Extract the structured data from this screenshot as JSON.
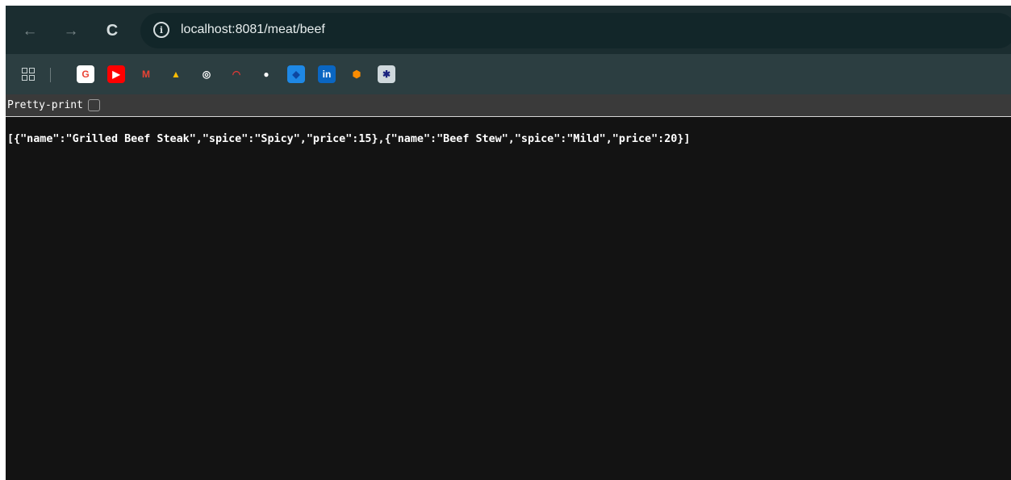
{
  "browser": {
    "url": "localhost:8081/meat/beef",
    "icons": {
      "back": "back-arrow-icon",
      "forward": "forward-arrow-icon",
      "reload": "reload-icon",
      "info": "info-icon"
    }
  },
  "bookmarks": [
    {
      "name": "apps-grid-icon"
    },
    {
      "name": "google-icon",
      "glyph": "G",
      "bg": "#ffffff",
      "fg": "#ea4335"
    },
    {
      "name": "youtube-icon",
      "glyph": "▶",
      "bg": "#ff0000",
      "fg": "#ffffff"
    },
    {
      "name": "gmail-icon",
      "glyph": "M",
      "bg": "transparent",
      "fg": "#ea4335"
    },
    {
      "name": "google-drive-icon",
      "glyph": "▲",
      "bg": "transparent",
      "fg": "#fbbc04"
    },
    {
      "name": "openai-icon",
      "glyph": "◎",
      "bg": "transparent",
      "fg": "#ffffff"
    },
    {
      "name": "speedometer-icon",
      "glyph": "◠",
      "bg": "transparent",
      "fg": "#e53935"
    },
    {
      "name": "github-icon",
      "glyph": "●",
      "bg": "transparent",
      "fg": "#ffffff"
    },
    {
      "name": "circle-app-icon",
      "glyph": "◆",
      "bg": "#1e88e5",
      "fg": "#0d47a1"
    },
    {
      "name": "linkedin-icon",
      "glyph": "in",
      "bg": "#0a66c2",
      "fg": "#ffffff"
    },
    {
      "name": "box-icon",
      "glyph": "⬢",
      "bg": "transparent",
      "fg": "#fb8c00"
    },
    {
      "name": "shield-seal-icon",
      "glyph": "✱",
      "bg": "#cfd8dc",
      "fg": "#1a237e"
    }
  ],
  "pretty_print": {
    "label": "Pretty-print"
  },
  "body_json": "[{\"name\":\"Grilled Beef Steak\",\"spice\":\"Spicy\",\"price\":15},{\"name\":\"Beef Stew\",\"spice\":\"Mild\",\"price\":20}]"
}
